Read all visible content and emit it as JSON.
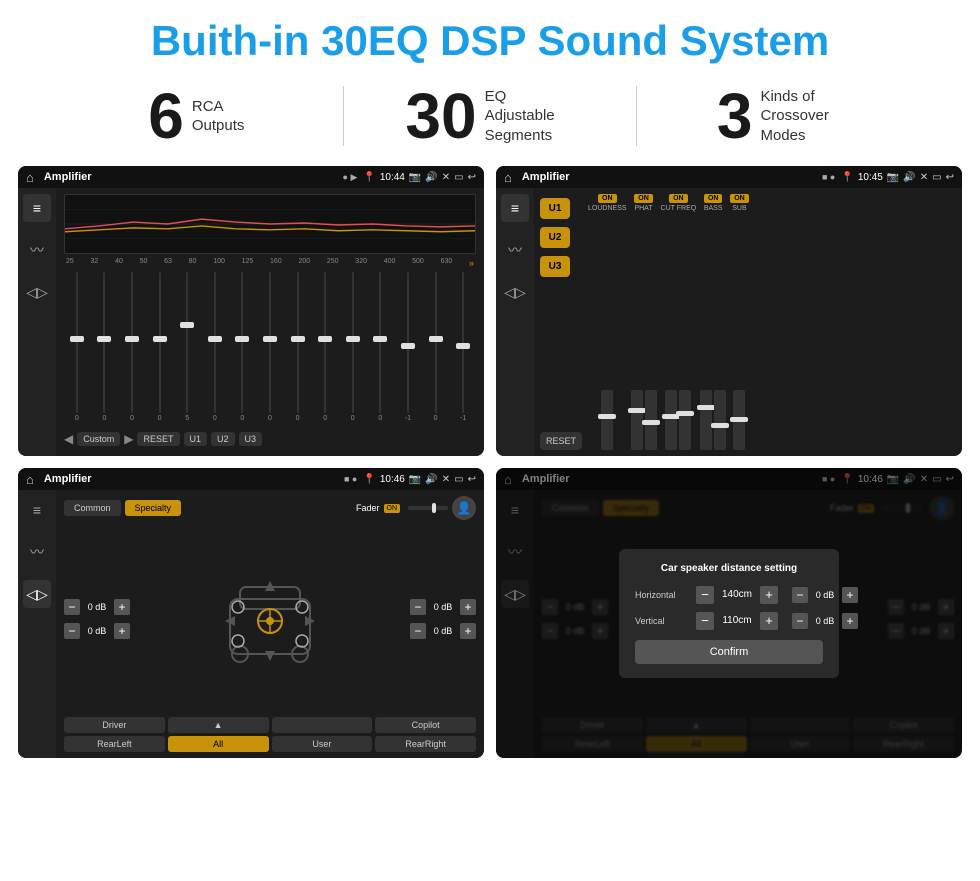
{
  "header": {
    "title": "Buith-in 30EQ DSP Sound System"
  },
  "stats": [
    {
      "number": "6",
      "text_line1": "RCA",
      "text_line2": "Outputs"
    },
    {
      "number": "30",
      "text_line1": "EQ Adjustable",
      "text_line2": "Segments"
    },
    {
      "number": "3",
      "text_line1": "Kinds of",
      "text_line2": "Crossover Modes"
    }
  ],
  "screens": [
    {
      "id": "screen-eq",
      "status_bar": {
        "title": "Amplifier",
        "time": "10:44"
      },
      "type": "eq"
    },
    {
      "id": "screen-crossover",
      "status_bar": {
        "title": "Amplifier",
        "time": "10:45"
      },
      "type": "crossover"
    },
    {
      "id": "screen-speaker",
      "status_bar": {
        "title": "Amplifier",
        "time": "10:46"
      },
      "type": "speaker"
    },
    {
      "id": "screen-dialog",
      "status_bar": {
        "title": "Amplifier",
        "time": "10:46"
      },
      "type": "dialog",
      "dialog": {
        "title": "Car speaker distance setting",
        "horizontal_label": "Horizontal",
        "horizontal_value": "140cm",
        "vertical_label": "Vertical",
        "vertical_value": "110cm",
        "confirm_label": "Confirm",
        "db_right_label": "0 dB"
      }
    }
  ],
  "eq": {
    "freqs": [
      "25",
      "32",
      "40",
      "50",
      "63",
      "80",
      "100",
      "125",
      "160",
      "200",
      "250",
      "320",
      "400",
      "500",
      "630"
    ],
    "values": [
      "0",
      "0",
      "0",
      "0",
      "5",
      "0",
      "0",
      "0",
      "0",
      "0",
      "0",
      "0",
      "-1",
      "0",
      "-1"
    ],
    "presets": [
      "Custom",
      "RESET",
      "U1",
      "U2",
      "U3"
    ]
  },
  "crossover": {
    "u_buttons": [
      "U1",
      "U2",
      "U3"
    ],
    "channels": [
      {
        "label": "LOUDNESS",
        "on": true
      },
      {
        "label": "PHAT",
        "on": true
      },
      {
        "label": "CUT FREQ",
        "on": true
      },
      {
        "label": "BASS",
        "on": true
      },
      {
        "label": "SUB",
        "on": true
      }
    ]
  },
  "speaker": {
    "mode_tabs": [
      "Common",
      "Specialty"
    ],
    "fader_label": "Fader",
    "fader_on": "ON",
    "db_values": [
      "0 dB",
      "0 dB",
      "0 dB",
      "0 dB"
    ],
    "bottom_buttons": [
      "Driver",
      "",
      "",
      "Copilot",
      "RearLeft",
      "All",
      "User",
      "RearRight"
    ]
  }
}
